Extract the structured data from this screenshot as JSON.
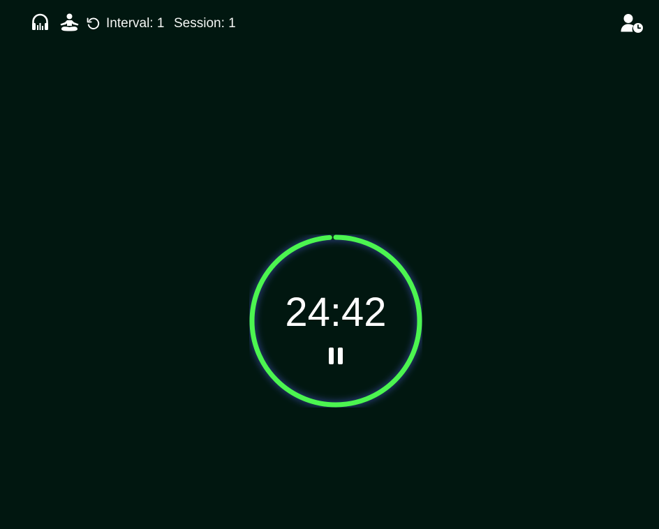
{
  "header": {
    "icons": {
      "audio": "headphones-icon",
      "meditation": "meditation-icon",
      "reset": "reset-icon",
      "profile": "user-clock-icon"
    },
    "interval_label": "Interval: 1",
    "session_label": "Session: 1"
  },
  "timer": {
    "time": "24:42",
    "progress": 0.988,
    "pause_icon": "pause-icon"
  },
  "colors": {
    "background": "#011710",
    "ring": "#4cf550",
    "glow": "#5a6cff",
    "text": "#ffffff"
  }
}
